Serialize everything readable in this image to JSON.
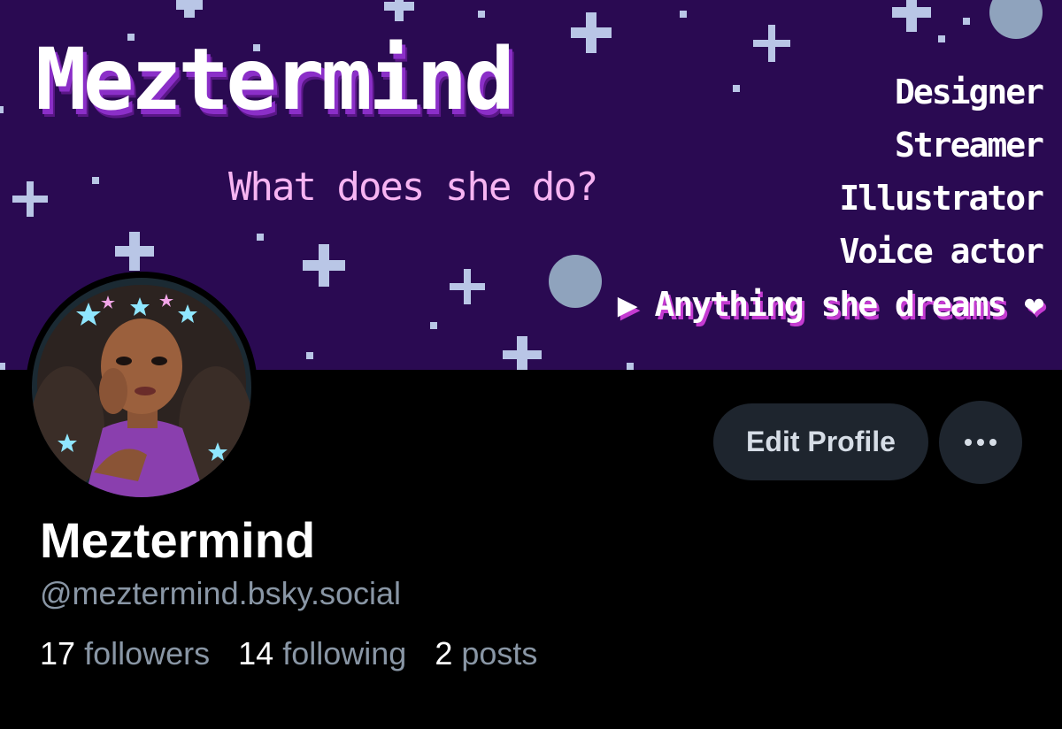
{
  "banner": {
    "title": "Meztermind",
    "tagline": "What does she do?",
    "roles": [
      "Designer",
      "Streamer",
      "Illustrator",
      "Voice actor"
    ],
    "highlight_role": "▶ Anything she dreams ❤",
    "colors": {
      "background": "#2a0a52",
      "star": "#b9c6e6",
      "tagline": "#f7b4f2",
      "title_shadow": "#8b2fc8"
    }
  },
  "profile": {
    "display_name": "Meztermind",
    "handle": "@meztermind.bsky.social"
  },
  "actions": {
    "edit_label": "Edit Profile",
    "more_icon": "ellipsis-icon"
  },
  "stats": [
    {
      "count": "17",
      "label": "followers"
    },
    {
      "count": "14",
      "label": "following"
    },
    {
      "count": "2",
      "label": "posts"
    }
  ]
}
